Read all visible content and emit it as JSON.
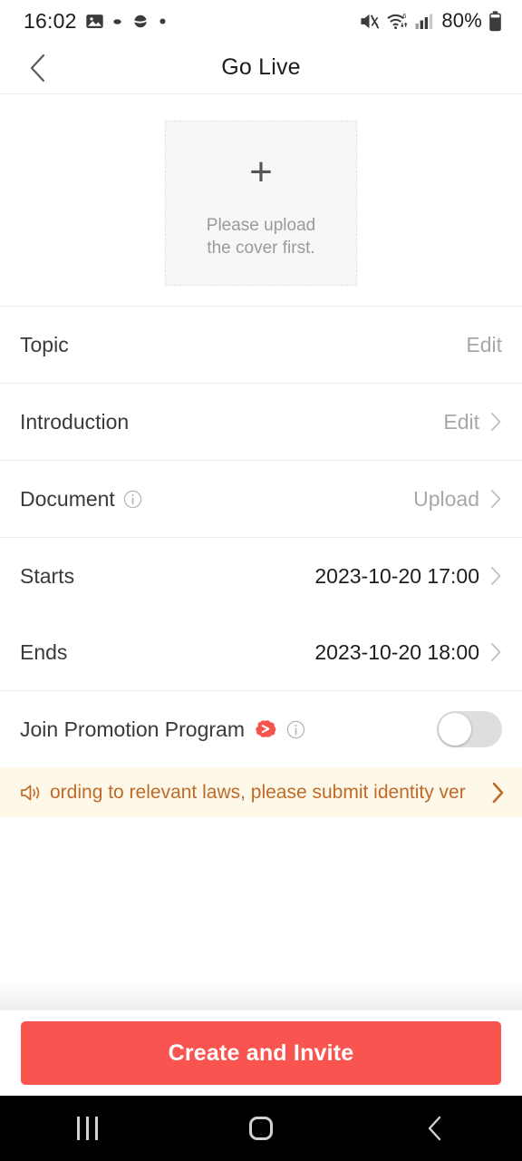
{
  "status_bar": {
    "time": "16:02",
    "battery_percent": "80%",
    "left_icons": [
      "photo-icon",
      "dot-icon",
      "saturn-icon",
      "dot-icon"
    ],
    "right_icons": [
      "mute-icon",
      "wifi-6-icon",
      "signal-bars-icon",
      "battery-icon"
    ]
  },
  "header": {
    "title": "Go Live",
    "back_icon": "chevron-left-icon"
  },
  "cover": {
    "plus": "+",
    "line1": "Please upload",
    "line2": "the cover first."
  },
  "rows": {
    "topic": {
      "label": "Topic",
      "action": "Edit"
    },
    "introduction": {
      "label": "Introduction",
      "action": "Edit"
    },
    "document": {
      "label": "Document",
      "action": "Upload"
    },
    "starts": {
      "label": "Starts",
      "value": "2023-10-20 17:00"
    },
    "ends": {
      "label": "Ends",
      "value": "2023-10-20 18:00"
    },
    "promotion": {
      "label": "Join Promotion Program",
      "toggle_state": "off"
    }
  },
  "banner": {
    "text": "ording to relevant laws, please submit identity ver",
    "icon": "speaker-announcement-icon",
    "chevron": "chevron-right-icon"
  },
  "footer": {
    "cta_label": "Create and Invite"
  },
  "nav_bar": {
    "recents": "recents-icon",
    "home": "home-icon",
    "back": "back-icon"
  },
  "colors": {
    "accent_red": "#f9544f",
    "banner_bg": "#fdf8e8",
    "banner_text": "#c06a2a",
    "promo_icon_red": "#f6544f"
  }
}
